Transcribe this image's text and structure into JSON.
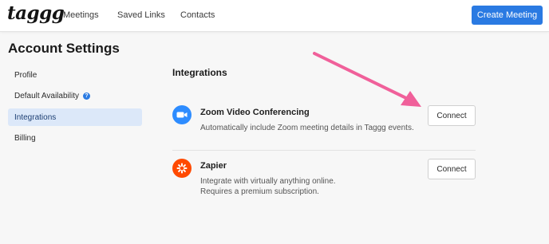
{
  "header": {
    "logo": "taggg",
    "nav": [
      {
        "label": "Meetings"
      },
      {
        "label": "Saved Links"
      },
      {
        "label": "Contacts"
      }
    ],
    "create_button": "Create Meeting"
  },
  "page_title": "Account Settings",
  "sidebar": {
    "items": [
      {
        "label": "Profile"
      },
      {
        "label": "Default Availability",
        "help": "?"
      },
      {
        "label": "Integrations",
        "active": true
      },
      {
        "label": "Billing"
      }
    ]
  },
  "integrations": {
    "title": "Integrations",
    "items": [
      {
        "name": "Zoom Video Conferencing",
        "description": "Automatically include Zoom meeting details in Taggg events.",
        "button": "Connect",
        "icon": "video-camera-icon"
      },
      {
        "name": "Zapier",
        "description_lines": [
          "Integrate with virtually anything online.",
          "Requires a premium subscription."
        ],
        "button": "Connect",
        "icon": "zapier-asterisk-icon"
      }
    ]
  },
  "colors": {
    "accent": "#2a7ae2",
    "active_nav_bg": "#dce8f9",
    "zoom": "#2d8cff",
    "zapier": "#ff4a00",
    "annotation_arrow": "#f0609a"
  }
}
